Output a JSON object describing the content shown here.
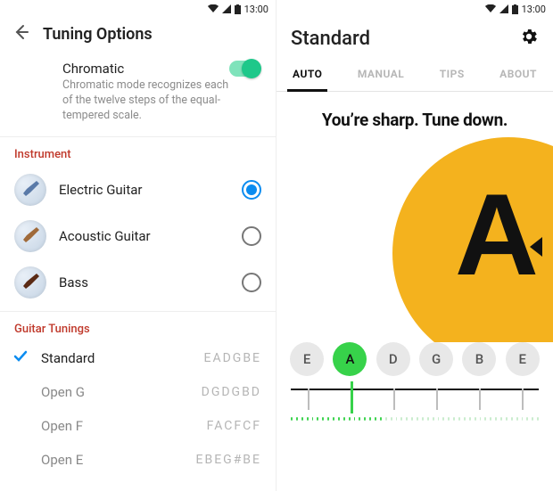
{
  "status": {
    "time": "13:00"
  },
  "left": {
    "title": "Tuning Options",
    "chromatic": {
      "title": "Chromatic",
      "desc": "Chromatic mode recognizes each of the twelve steps of the equal-tempered scale.",
      "enabled": true
    },
    "instrument_label": "Instrument",
    "instruments": [
      {
        "label": "Electric Guitar",
        "selected": true
      },
      {
        "label": "Acoustic Guitar",
        "selected": false
      },
      {
        "label": "Bass",
        "selected": false
      }
    ],
    "tunings_label": "Guitar Tunings",
    "tunings": [
      {
        "name": "Standard",
        "notes": "EADGBE",
        "selected": true
      },
      {
        "name": "Open G",
        "notes": "DGDGBD",
        "selected": false
      },
      {
        "name": "Open F",
        "notes": "FACFCF",
        "selected": false
      },
      {
        "name": "Open E",
        "notes": "EBEG#BE",
        "selected": false
      }
    ]
  },
  "right": {
    "title": "Standard",
    "tabs": [
      "AUTO",
      "MANUAL",
      "TIPS",
      "ABOUT"
    ],
    "active_tab": 0,
    "message": "You’re sharp. Tune down.",
    "note": "A",
    "direction": "down",
    "strings": [
      "E",
      "A",
      "D",
      "G",
      "B",
      "E"
    ],
    "active_string": 1
  }
}
